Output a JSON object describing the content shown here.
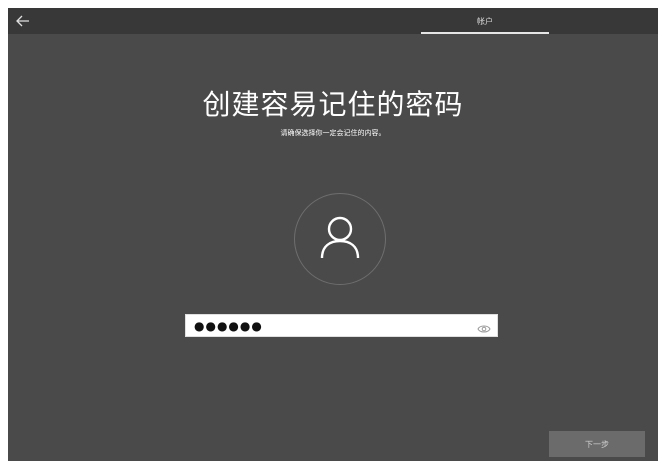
{
  "header": {
    "back_icon": "arrow-left-icon",
    "tab_label": "帐户"
  },
  "main": {
    "title": "创建容易记住的密码",
    "subtitle": "请确保选择你一定会记住的内容。",
    "avatar_icon": "user-icon",
    "password": {
      "value": "●●●●●●",
      "reveal_icon": "eye-icon"
    }
  },
  "footer": {
    "next_label": "下一步"
  },
  "colors": {
    "background": "#4a4a4a",
    "topbar": "#383838",
    "text": "#ffffff",
    "button": "#6b6b6b"
  }
}
